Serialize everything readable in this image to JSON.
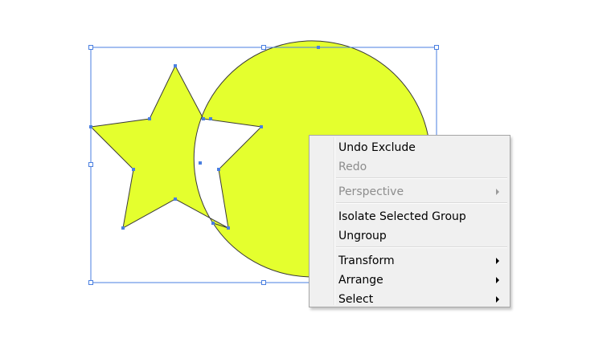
{
  "canvas": {
    "shape_fill": "#e4ff2e",
    "shape_stroke": "#3a3a3a",
    "selection_color": "#4a7fe0"
  },
  "context_menu": {
    "items": [
      {
        "label": "Undo Exclude",
        "enabled": true,
        "submenu": false
      },
      {
        "label": "Redo",
        "enabled": false,
        "submenu": false
      },
      {
        "label": "Perspective",
        "enabled": false,
        "submenu": true
      },
      {
        "label": "Isolate Selected Group",
        "enabled": true,
        "submenu": false
      },
      {
        "label": "Ungroup",
        "enabled": true,
        "submenu": false
      },
      {
        "label": "Transform",
        "enabled": true,
        "submenu": true
      },
      {
        "label": "Arrange",
        "enabled": true,
        "submenu": true
      },
      {
        "label": "Select",
        "enabled": true,
        "submenu": true
      }
    ]
  }
}
